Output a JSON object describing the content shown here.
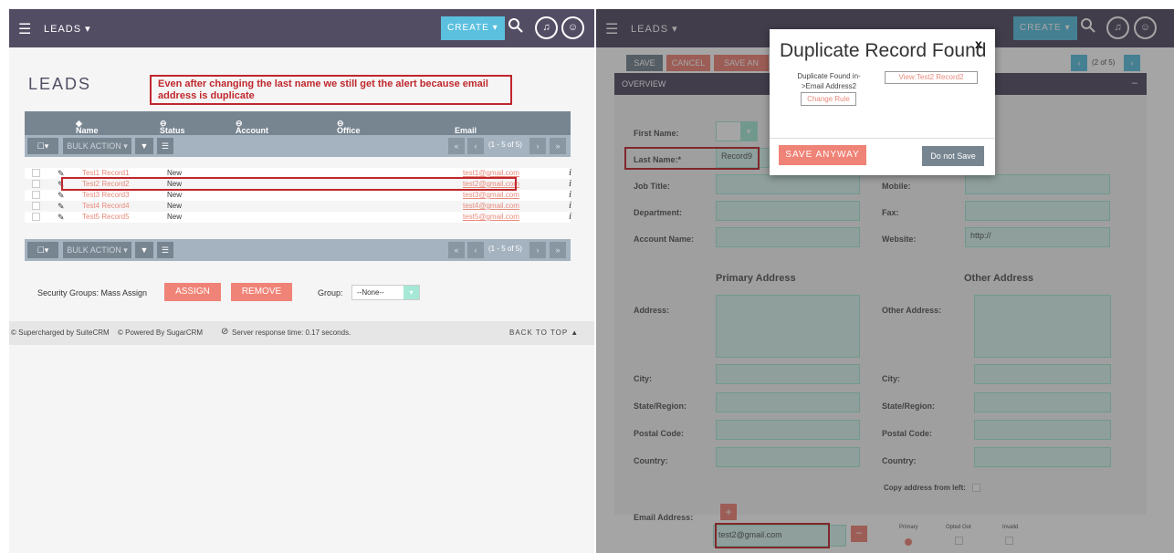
{
  "left": {
    "module": "LEADS",
    "create_label": "CREATE",
    "page_title": "LEADS",
    "annotation": "Even after changing the last name we still get the alert because email address is duplicate",
    "columns": [
      "Name",
      "Status",
      "Account Name",
      "Office Phone",
      "Email"
    ],
    "bulk_action": "BULK ACTION",
    "pagination": "(1 - 5 of 5)",
    "rows": [
      {
        "name": "Test1 Record1",
        "status": "New",
        "email": "test1@gmail.com"
      },
      {
        "name": "Test2 Record2",
        "status": "New",
        "email": "test2@gmail.com"
      },
      {
        "name": "Test3 Record3",
        "status": "New",
        "email": "test3@gmail.com"
      },
      {
        "name": "Test4 Record4",
        "status": "New",
        "email": "test4@gmail.com"
      },
      {
        "name": "Test5 Record5",
        "status": "New",
        "email": "test5@gmail.com"
      }
    ],
    "info_glyph": "i",
    "security_label": "Security Groups: Mass Assign",
    "assign": "ASSIGN",
    "remove": "REMOVE",
    "group_label": "Group:",
    "group_value": "--None--",
    "footer_suite": "© Supercharged by SuiteCRM",
    "footer_sugar": "© Powered By SugarCRM",
    "footer_response": "Server response time: 0.17 seconds.",
    "back_to_top": "BACK TO TOP ▲"
  },
  "right": {
    "module": "LEADS",
    "create_label": "CREATE",
    "save": "SAVE",
    "cancel": "CANCEL",
    "save_and": "SAVE AN",
    "pager": "(2 of 5)",
    "overview": "OVERVIEW",
    "collapse": "–",
    "fields": {
      "first_name": "First Name:",
      "last_name": "Last Name:*",
      "last_name_value": "Record9",
      "job_title": "Job Title:",
      "mobile": "Mobile:",
      "department": "Department:",
      "fax": "Fax:",
      "account_name": "Account Name:",
      "website": "Website:",
      "website_value": "http://",
      "primary_address": "Primary Address",
      "other_address": "Other Address",
      "address": "Address:",
      "other_address_label": "Other Address:",
      "city": "City:",
      "state": "State/Region:",
      "postal": "Postal Code:",
      "country": "Country:",
      "copy_address": "Copy address from left:",
      "email_address": "Email Address:",
      "email_value": "test2@gmail.com",
      "primary": "Primary",
      "opted_out": "Opted Out",
      "invalid": "Invalid"
    },
    "modal": {
      "title": "Duplicate Record Found",
      "close": "x",
      "found_text": "Duplicate Found in->Email Address2",
      "view_link": "View:Test2 Record2",
      "change_rule": "Change Rule",
      "save_anyway": "SAVE ANYWAY",
      "do_not_save": "Do not Save"
    }
  },
  "colors": {
    "topbar": "#534d64",
    "accent": "#f08377",
    "annotation": "#c0272d"
  }
}
